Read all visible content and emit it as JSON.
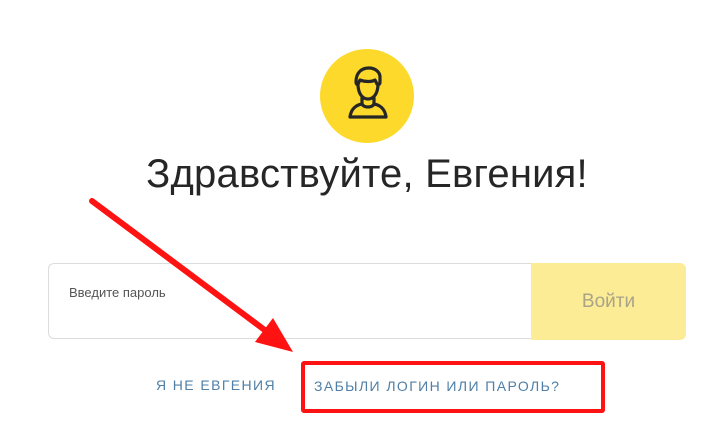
{
  "avatar": {
    "icon": "user-silhouette-icon",
    "background": "#fdd92b"
  },
  "greeting": "Здравствуйте, Евгения!",
  "password": {
    "placeholder": "Введите пароль",
    "value": ""
  },
  "login_button": {
    "label": "Войти",
    "background": "#fdec96"
  },
  "links": {
    "not_me": "Я НЕ ЕВГЕНИЯ",
    "forgot": "ЗАБЫЛИ ЛОГИН ИЛИ ПАРОЛЬ?"
  },
  "annotation": {
    "color": "#ff1212",
    "arrow_icon": "red-arrow-icon"
  }
}
